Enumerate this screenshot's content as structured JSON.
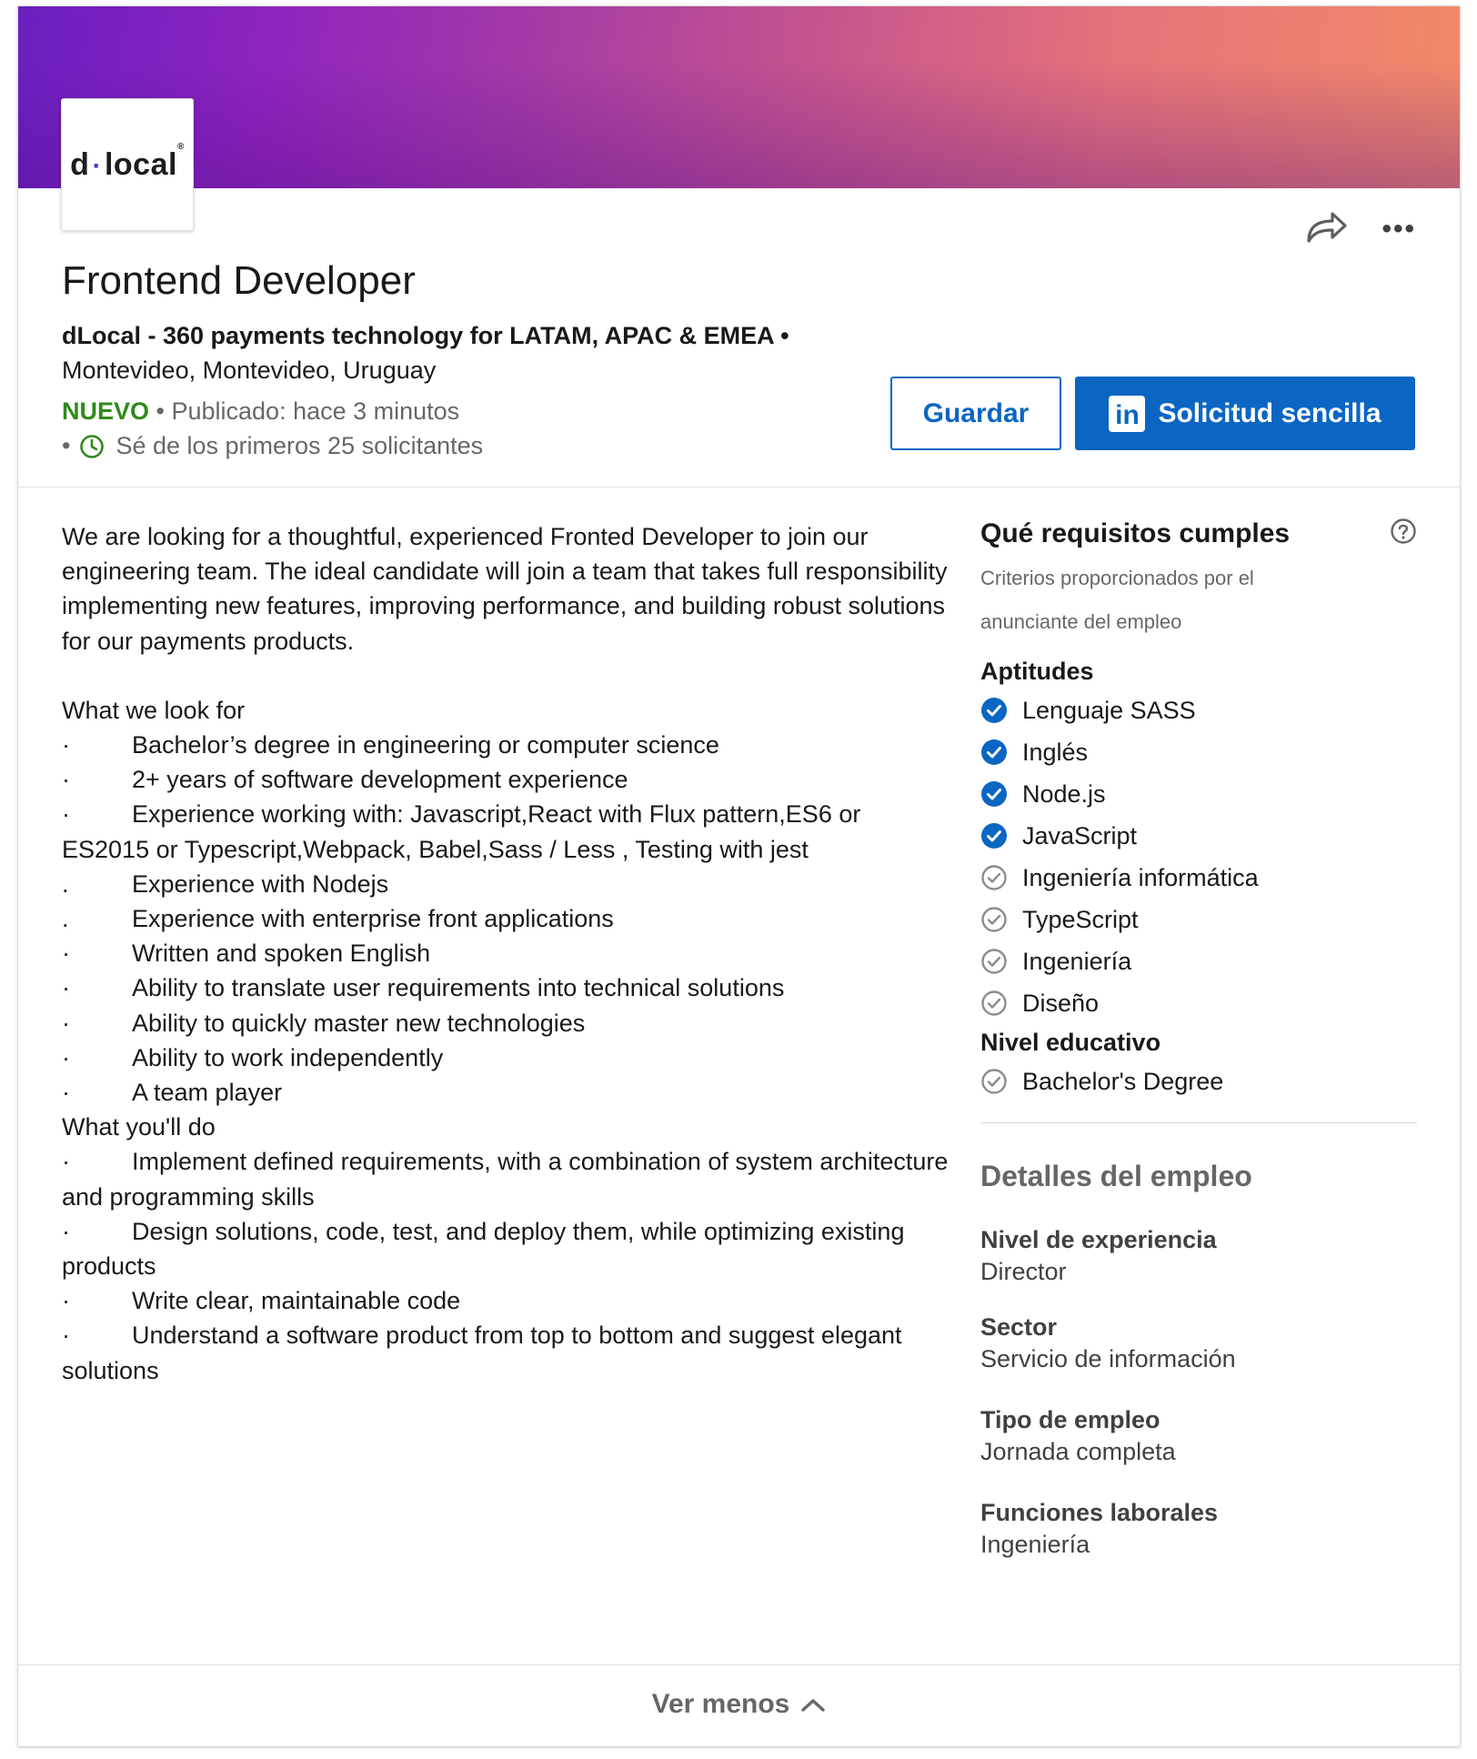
{
  "header": {
    "logo_text_left": "d",
    "logo_text_dot": "·",
    "logo_text_right": "local",
    "logo_reg": "®",
    "title": "Frontend Developer",
    "company": "dLocal - 360 payments technology for LATAM, APAC & EMEA •",
    "location": "Montevideo, Montevideo, Uruguay",
    "new_badge": "NUEVO",
    "published": " • Publicado: hace 3 minutos",
    "applicants_prefix": "•",
    "applicants": "Sé de los primeros 25 solicitantes",
    "save_label": "Guardar",
    "apply_label": "Solicitud sencilla",
    "apply_icon_text": "in"
  },
  "description": {
    "intro": "We are looking for a thoughtful, experienced Fronted Developer to join our engineering team. The ideal candidate will join a team that takes full responsibility implementing new features, improving performance, and building robust solutions for our payments products.",
    "look_for_title": "What we look for",
    "look_for": [
      {
        "b": "·",
        "t": "Bachelor’s degree in engineering or computer science"
      },
      {
        "b": "·",
        "t": "2+ years of software development experience"
      },
      {
        "b": "·",
        "t": "Experience working with:  Javascript,React with Flux pattern,ES6 or ES2015 or Typescript,Webpack, Babel,Sass / Less , Testing with jest"
      },
      {
        "b": ".",
        "t": "Experience with Nodejs"
      },
      {
        "b": ".",
        "t": "Experience with enterprise front applications"
      },
      {
        "b": "·",
        "t": "Written and spoken English"
      },
      {
        "b": "·",
        "t": "Ability to translate user requirements into technical solutions"
      },
      {
        "b": "·",
        "t": "Ability to quickly master new technologies"
      },
      {
        "b": "·",
        "t": "Ability to work independently"
      },
      {
        "b": "·",
        "t": "A team player"
      }
    ],
    "do_title": "What you'll do",
    "do": [
      {
        "b": "·",
        "t": "Implement defined requirements, with a combination of system architecture and programming skills"
      },
      {
        "b": "·",
        "t": "Design solutions, code, test, and deploy them, while optimizing existing products"
      },
      {
        "b": "·",
        "t": "Write clear, maintainable code"
      },
      {
        "b": "·",
        "t": "Understand a software product from top to bottom and suggest elegant solutions"
      }
    ]
  },
  "sidebar": {
    "title": "Qué requisitos cumples",
    "subtitle": "Criterios proporcionados por el anunciante del empleo",
    "skills_title": "Aptitudes",
    "skills": [
      {
        "label": "Lenguaje SASS",
        "matched": true
      },
      {
        "label": "Inglés",
        "matched": true
      },
      {
        "label": "Node.js",
        "matched": true
      },
      {
        "label": "JavaScript",
        "matched": true
      },
      {
        "label": "Ingeniería informática",
        "matched": false
      },
      {
        "label": "TypeScript",
        "matched": false
      },
      {
        "label": "Ingeniería",
        "matched": false
      },
      {
        "label": "Diseño",
        "matched": false
      }
    ],
    "education_title": "Nivel educativo",
    "education": [
      {
        "label": "Bachelor's Degree",
        "matched": false
      }
    ],
    "details_title": "Detalles del empleo",
    "details": [
      {
        "label": "Nivel de experiencia",
        "value": "Director"
      },
      {
        "label": "Sector",
        "value": "Servicio de información"
      },
      {
        "label": "Tipo de empleo",
        "value": "Jornada completa"
      },
      {
        "label": "Funciones laborales",
        "value": "Ingeniería"
      }
    ]
  },
  "footer": {
    "toggle_label": "Ver menos"
  },
  "colors": {
    "linkedin_blue": "#0a66c2",
    "new_green": "#2f8a1b",
    "matched_check": "#0a66c2",
    "unmatched_check": "#8c8c8c"
  },
  "icons": {
    "share": "share-arrow-icon",
    "more": "ellipsis-icon",
    "clock": "clock-icon",
    "help": "question-circle-icon",
    "check_matched": "check-circle-filled-icon",
    "check_unmatched": "check-circle-outline-icon",
    "chevron": "chevron-up-icon"
  }
}
